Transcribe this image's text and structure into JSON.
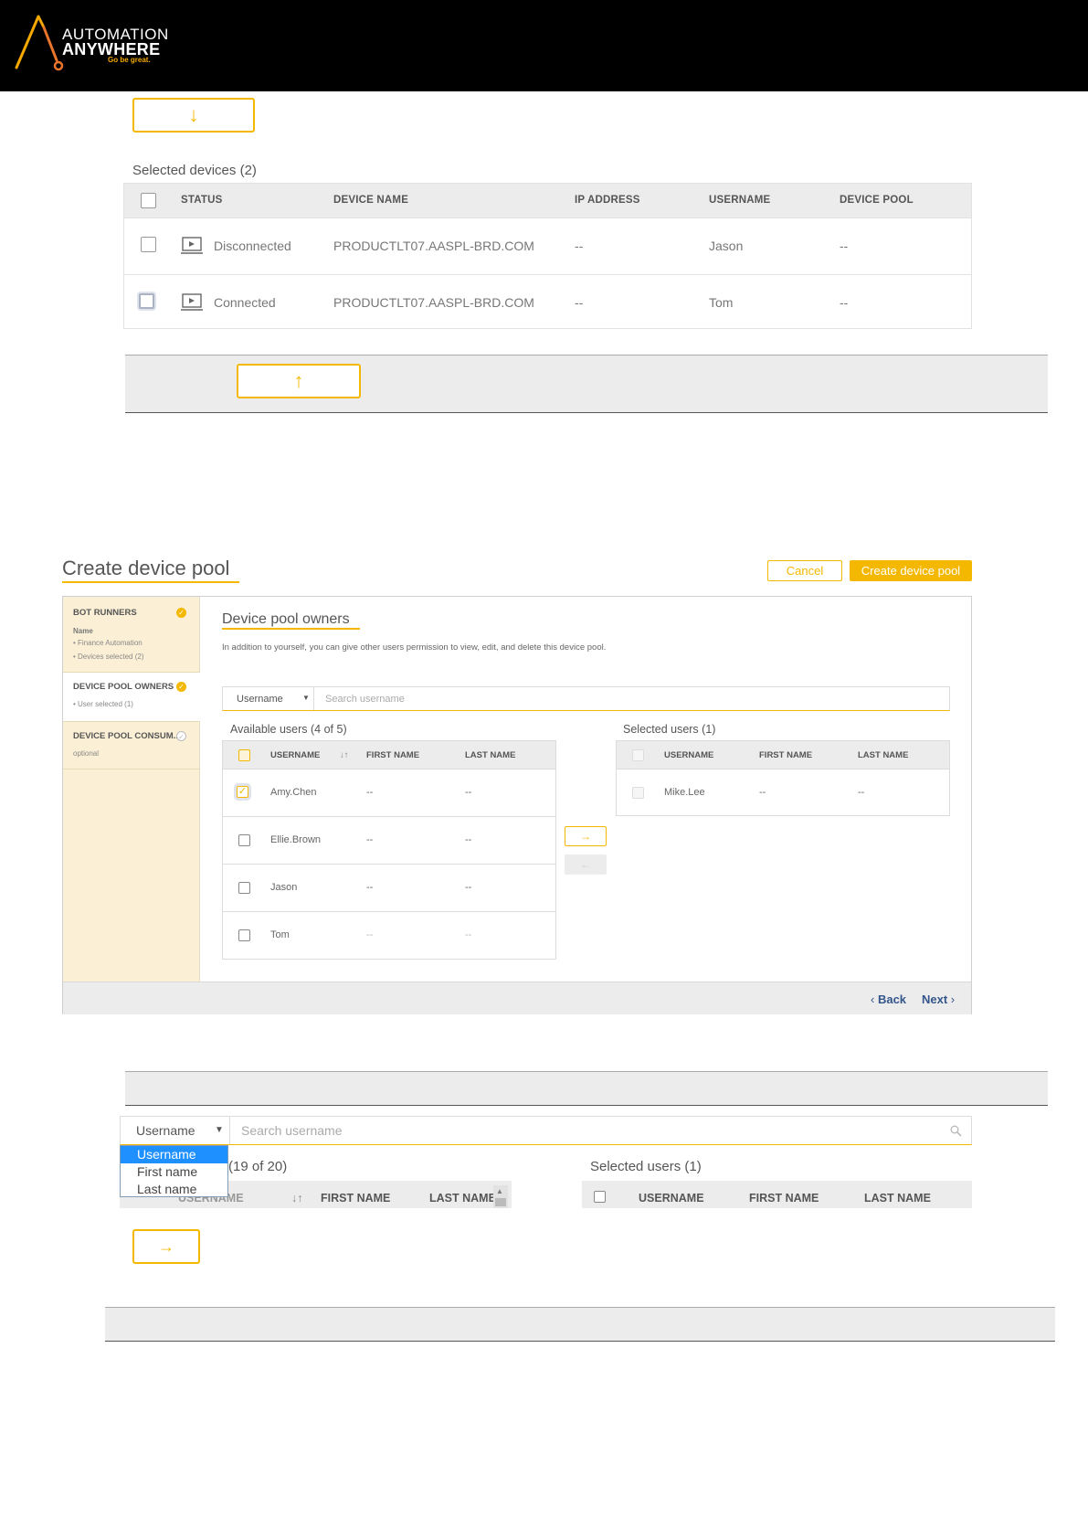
{
  "logo": {
    "line1": "AUTOMATION",
    "line2": "ANYWHERE",
    "tagline": "Go be great.",
    "accent": "#f5a800"
  },
  "section1": {
    "down_button_glyph": "↓",
    "selected_devices_title": "Selected devices (2)",
    "columns": [
      "STATUS",
      "DEVICE NAME",
      "IP ADDRESS",
      "USERNAME",
      "DEVICE POOL"
    ],
    "rows": [
      {
        "status": "Disconnected",
        "device_name": "PRODUCTLT07.AASPL-BRD.COM",
        "ip": "--",
        "username": "Jason",
        "pool": "--"
      },
      {
        "status": "Connected",
        "device_name": "PRODUCTLT07.AASPL-BRD.COM",
        "ip": "--",
        "username": "Tom",
        "pool": "--"
      }
    ],
    "up_button_glyph": "↑"
  },
  "create_pool": {
    "title": "Create device pool",
    "cancel_label": "Cancel",
    "create_label": "Create device pool",
    "steps": [
      {
        "title": "BOT RUNNERS",
        "label": "Name",
        "sub1": "• Finance Automation",
        "sub2": "• Devices selected (2)"
      },
      {
        "title": "DEVICE POOL OWNERS",
        "sub1": "• User selected (1)"
      },
      {
        "title": "DEVICE POOL CONSUM...",
        "sub1": "optional"
      }
    ],
    "section_title": "Device pool owners",
    "description": "In addition to yourself, you can give other users permission to view, edit, and delete this device pool.",
    "search_select": "Username",
    "search_placeholder": "Search username",
    "available_title": "Available users (4 of 5)",
    "selected_title": "Selected users (1)",
    "columns": [
      "USERNAME",
      "FIRST NAME",
      "LAST NAME"
    ],
    "available_users": [
      {
        "username": "Amy.Chen",
        "first": "--",
        "last": "--",
        "checked": true
      },
      {
        "username": "Ellie.Brown",
        "first": "--",
        "last": "--",
        "checked": false
      },
      {
        "username": "Jason",
        "first": "--",
        "last": "--",
        "checked": false
      },
      {
        "username": "Tom",
        "first": "--",
        "last": "--",
        "checked": false
      }
    ],
    "selected_users": [
      {
        "username": "Mike.Lee",
        "first": "--",
        "last": "--"
      }
    ],
    "move_right_glyph": "→",
    "move_left_glyph": "←",
    "back_label": "Back",
    "next_label": "Next"
  },
  "section3": {
    "search_select": "Username",
    "search_placeholder": "Search username",
    "dropdown_options": [
      "Username",
      "First name",
      "Last name"
    ],
    "available_title_partial": "(19 of 20)",
    "selected_title": "Selected users (1)",
    "columns_left": [
      "USERNAME",
      "FIRST NAME",
      "LAST NAME"
    ],
    "columns_right": [
      "USERNAME",
      "FIRST NAME",
      "LAST NAME"
    ],
    "right_arrow_glyph": "→"
  }
}
